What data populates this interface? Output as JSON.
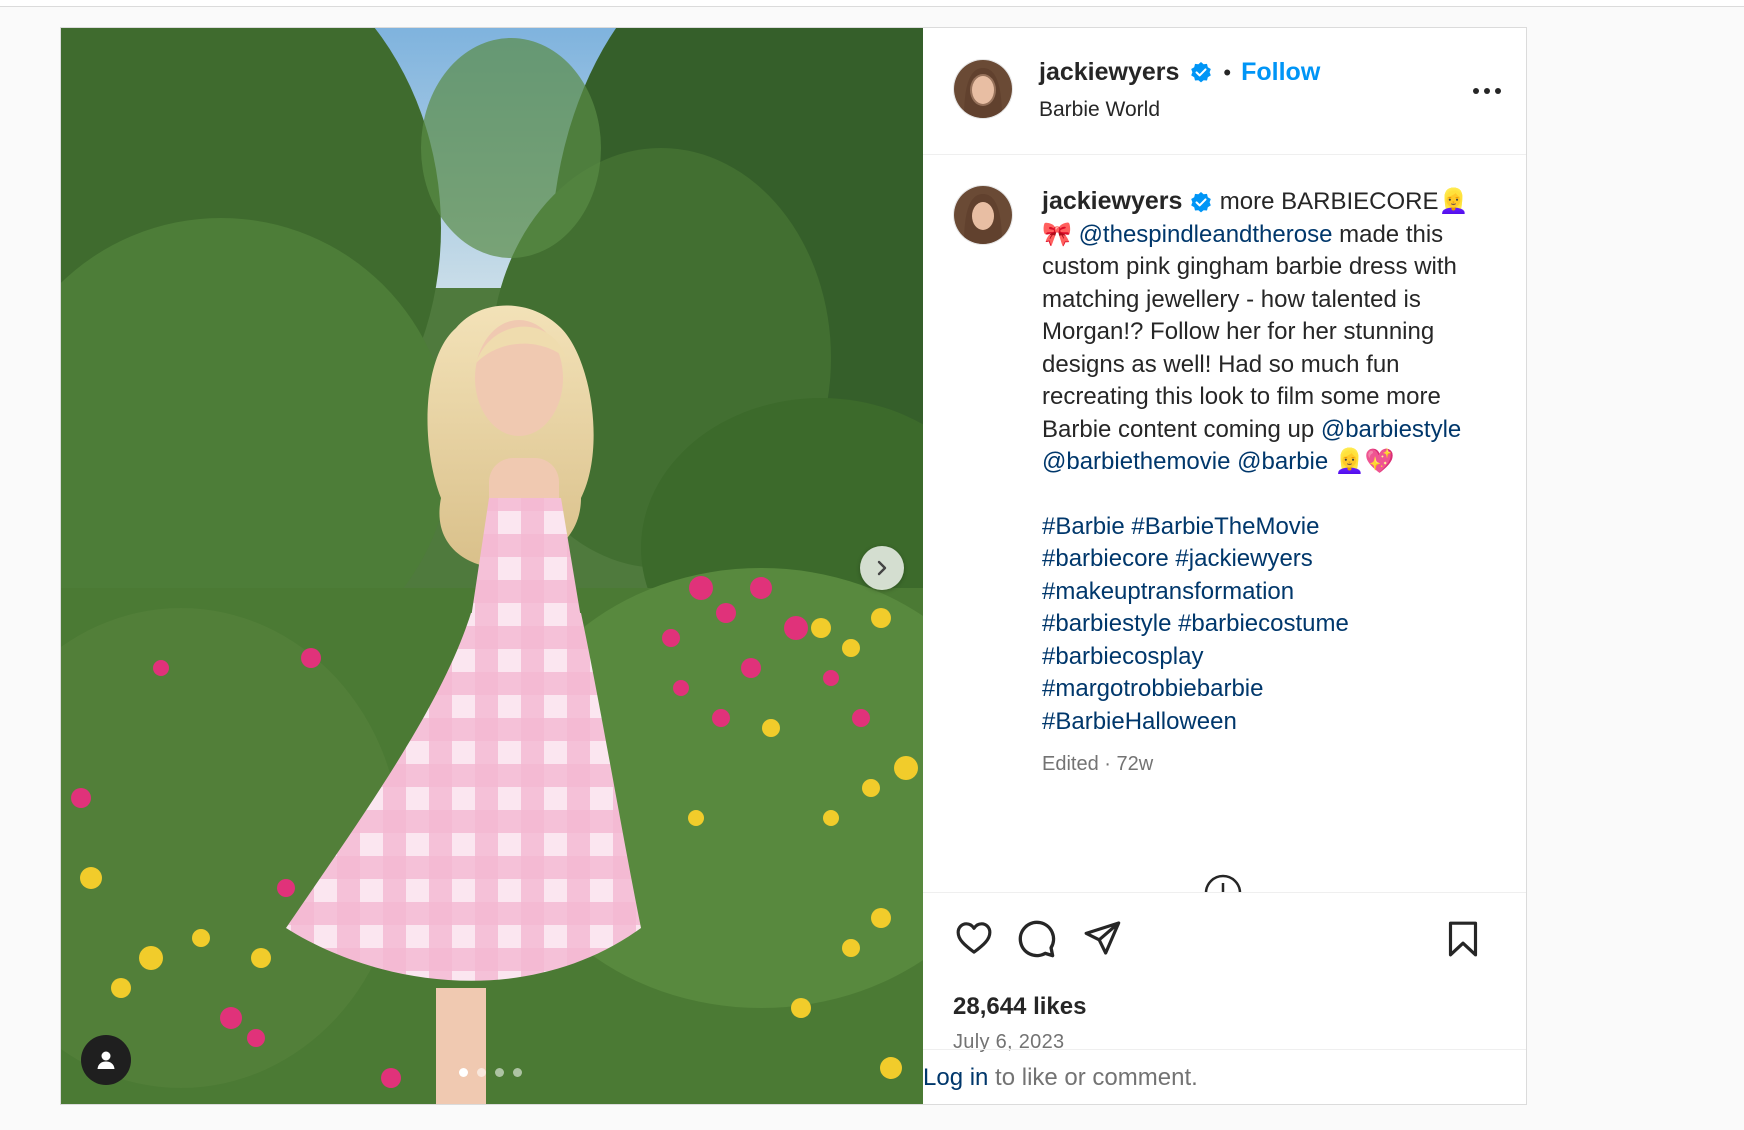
{
  "post": {
    "username": "jackiewyers",
    "follow_label": "Follow",
    "location": "Barbie World",
    "separator": "•",
    "caption": {
      "intro": "more BARBIECORE",
      "intro_emoji": "👱‍♀️",
      "bow_emoji": "🎀",
      "mention_1": "@thespindleandtherose",
      "text_1": "made this custom pink gingham barbie dress with matching jewellery - how talented is Morgan!? Follow her for her stunning designs as well! Had so much fun recreating this look to film some more Barbie content coming up",
      "mention_2": "@barbiestyle",
      "mention_3": "@barbiethemovie",
      "mention_4": "@barbie",
      "end_emoji": "👱‍♀️💖",
      "hashtags": [
        "#Barbie #BarbieTheMovie",
        "#barbiecore #jackiewyers",
        "#makeuptransformation",
        "#barbiestyle #barbiecostume",
        "#barbiecosplay",
        "#margotrobbiebarbie",
        "#BarbieHalloween"
      ],
      "meta": "Edited · 72w"
    },
    "likes": "28,644 likes",
    "date": "July 6, 2023",
    "login_link": "Log in",
    "login_rest": " to like or comment.",
    "carousel": {
      "slides": 4,
      "active_slide": 1
    }
  },
  "colors": {
    "follow_blue": "#0095f6",
    "link_blue": "#00376b",
    "verified_blue": "#0095f6",
    "secondary_text": "#737373"
  },
  "icons": [
    "verified-badge-icon",
    "more-options-icon",
    "heart-icon",
    "comment-icon",
    "share-icon",
    "bookmark-icon",
    "chevron-right-icon",
    "user-tag-icon"
  ]
}
